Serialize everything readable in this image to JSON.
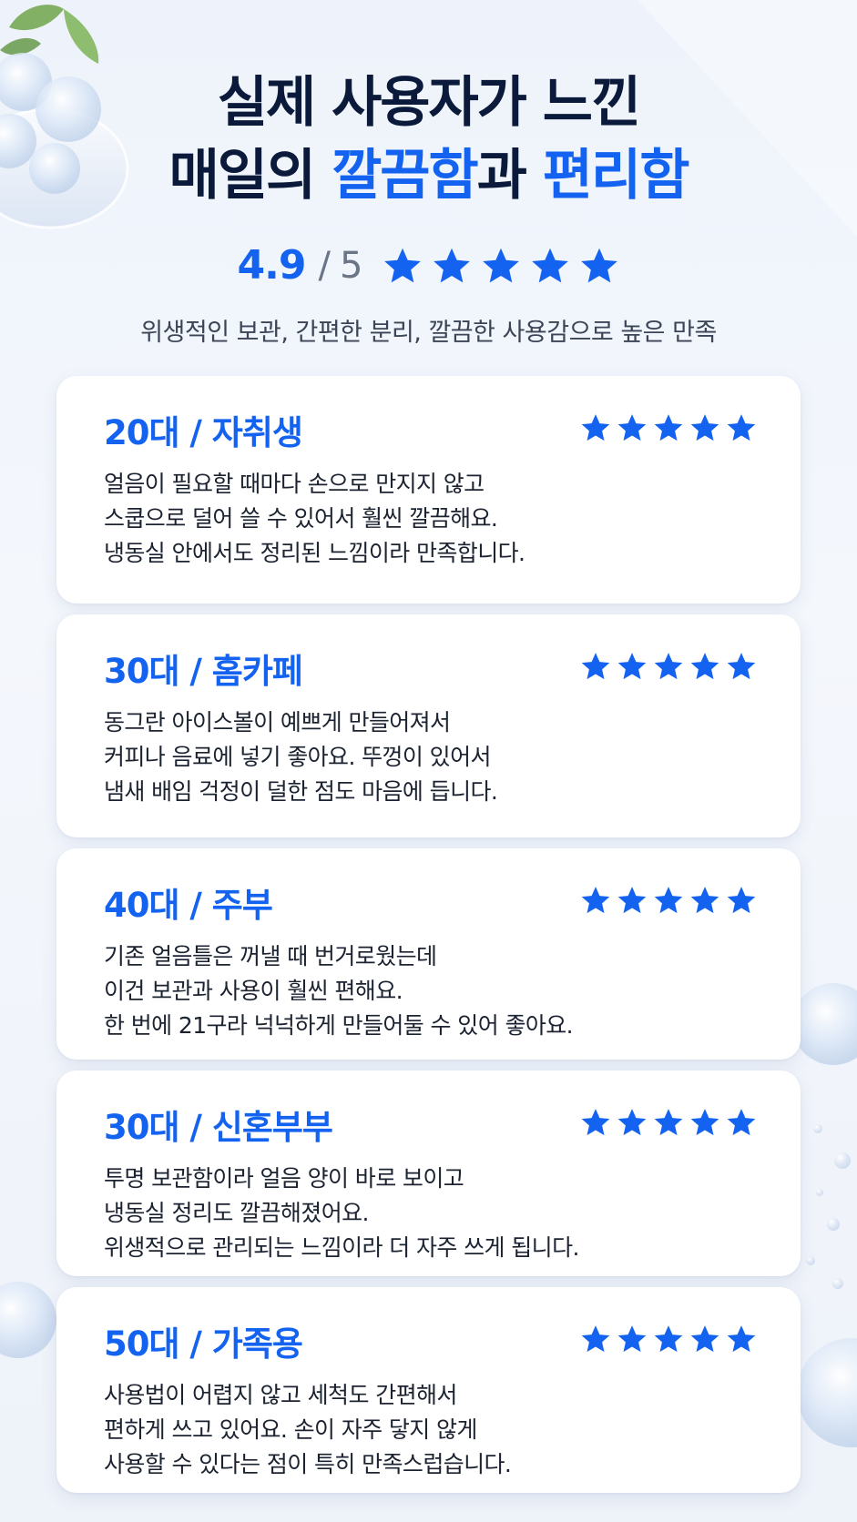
{
  "header": {
    "title_line1": "실제 사용자가 느낀",
    "title_line2_prefix": "매일의 ",
    "title_line2_accent1": "깔끔함",
    "title_line2_mid": "과 ",
    "title_line2_accent2": "편리함",
    "rating_score": "4.9",
    "rating_sep": "/",
    "rating_max": "5",
    "rating_stars": 5,
    "subtitle": "위생적인 보관, 간편한 분리, 깔끔한 사용감으로 높은 만족"
  },
  "colors": {
    "accent": "#1463f0",
    "title": "#0b1a3a",
    "body_text": "#1b2230",
    "muted": "#6a7587",
    "card_bg": "#ffffff"
  },
  "icons": {
    "star": "star-icon"
  },
  "reviews": [
    {
      "title": "20대 / 자취생",
      "stars": 5,
      "lines": [
        "얼음이 필요할 때마다 손으로 만지지 않고",
        "스쿱으로 덜어 쓸 수 있어서 훨씬 깔끔해요.",
        "냉동실 안에서도 정리된 느낌이라 만족합니다."
      ]
    },
    {
      "title": "30대 / 홈카페",
      "stars": 5,
      "lines": [
        "동그란 아이스볼이 예쁘게 만들어져서",
        "커피나 음료에 넣기 좋아요. 뚜껑이 있어서",
        "냄새 배임 걱정이 덜한 점도 마음에 듭니다."
      ]
    },
    {
      "title": "40대 / 주부",
      "stars": 5,
      "lines": [
        "기존 얼음틀은 꺼낼 때 번거로웠는데",
        "이건 보관과 사용이 훨씬 편해요.",
        "한 번에 21구라 넉넉하게 만들어둘 수 있어 좋아요."
      ]
    },
    {
      "title": "30대 / 신혼부부",
      "stars": 5,
      "lines": [
        "투명 보관함이라 얼음 양이 바로 보이고",
        "냉동실 정리도 깔끔해졌어요.",
        "위생적으로 관리되는 느낌이라 더 자주 쓰게 됩니다."
      ]
    },
    {
      "title": "50대 / 가족용",
      "stars": 5,
      "lines": [
        "사용법이 어렵지 않고 세척도 간편해서",
        "편하게 쓰고 있어요. 손이 자주 닿지 않게",
        "사용할 수 있다는 점이 특히 만족스럽습니다."
      ]
    }
  ]
}
